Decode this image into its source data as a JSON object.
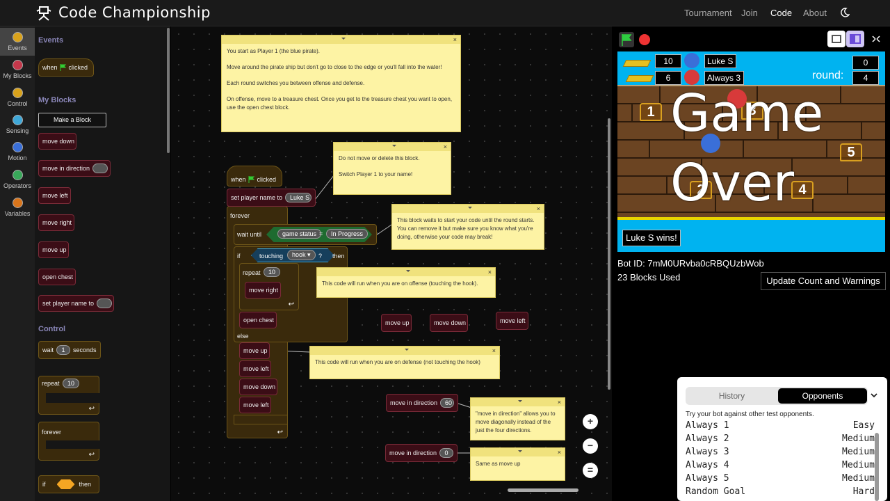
{
  "nav": {
    "brand": "Code Championship",
    "items": [
      "Tournament",
      "Join",
      "Code",
      "About"
    ],
    "active": "Code",
    "theme_icon": "moon-icon"
  },
  "categories": [
    {
      "label": "Events",
      "color": "#d9a21b"
    },
    {
      "label": "My Blocks",
      "color": "#c4384b"
    },
    {
      "label": "Control",
      "color": "#d9a21b"
    },
    {
      "label": "Sensing",
      "color": "#3fa8d8"
    },
    {
      "label": "Motion",
      "color": "#3a6fd8"
    },
    {
      "label": "Operators",
      "color": "#39a85a"
    },
    {
      "label": "Variables",
      "color": "#d9751b"
    }
  ],
  "flyout": {
    "events_title": "Events",
    "when_clicked": [
      "when",
      "clicked"
    ],
    "myblocks_title": "My Blocks",
    "make_block": "Make a Block",
    "my_blocks": [
      "move down",
      "move in direction",
      "move left",
      "move right",
      "move up",
      "open chest",
      "set player name to"
    ],
    "control_title": "Control",
    "wait": [
      "wait",
      "1",
      "seconds"
    ],
    "repeat": [
      "repeat",
      "10"
    ],
    "forever": "forever",
    "if": [
      "if",
      "then"
    ]
  },
  "notes": {
    "n1": [
      "You start as Player 1 (the blue pirate).",
      "Move around the pirate ship but don't go to close to the edge or you'll fall into the water!",
      "Each round switches you between offense and defense.",
      "On offense, move to a treasure chest. Once you get to the treasure chest you want to open, use the open chest block."
    ],
    "n2": [
      "Do not move or delete this block.",
      "Switch Player 1 to your name!"
    ],
    "n3": [
      "This block waits to start your code until the round starts. You can remove it but make sure you know what you're doing, otherwise your code may break!"
    ],
    "n4": [
      "This code will run when you are on offense (touching the hook)."
    ],
    "n5": [
      "This code will run when you are on defense (not touching the hook)"
    ],
    "n6": [
      "\"move in direction\" allows you to move diagonally instead of the just the four directions."
    ],
    "n7": [
      "Same as move up"
    ]
  },
  "script": {
    "when": [
      "when",
      "clicked"
    ],
    "set_name": [
      "set player name to",
      "Luke S"
    ],
    "forever": "forever",
    "wait_until": [
      "wait until",
      "game status",
      "=",
      "In Progress"
    ],
    "if": [
      "if",
      "touching",
      "hook",
      "?",
      "then"
    ],
    "repeat": [
      "repeat",
      "10"
    ],
    "move_right": "move right",
    "open_chest": "open chest",
    "else": "else",
    "defense": [
      "move up",
      "move left",
      "move down",
      "move left"
    ],
    "loose": [
      "move up",
      "move down",
      "move left"
    ],
    "mid1": [
      "move in direction",
      "60"
    ],
    "mid2": [
      "move in direction",
      "0"
    ]
  },
  "zoom": [
    "+",
    "−",
    "="
  ],
  "game": {
    "p1_score": "10",
    "p1_name": "Luke S",
    "p2_score": "6",
    "p2_name": "Always 3",
    "round_label": "round:",
    "right_top": "0",
    "round": "4",
    "chests": [
      "1",
      "3",
      "5",
      "2",
      "4"
    ],
    "game_over": [
      "Game",
      "Over"
    ],
    "winner": "Luke S wins!"
  },
  "bot": {
    "id": "Bot ID: 7mM0URvba0cRBQUzbWob",
    "blocks": "23 Blocks Used",
    "update": "Update Count and Warnings"
  },
  "history": {
    "tabs": [
      "History",
      "Opponents"
    ],
    "active_tab": "Opponents",
    "hint": "Try your bot against other test opponents.",
    "opponents": [
      {
        "name": "Always 1",
        "difficulty": "Easy"
      },
      {
        "name": "Always 2",
        "difficulty": "Medium"
      },
      {
        "name": "Always 3",
        "difficulty": "Medium"
      },
      {
        "name": "Always 4",
        "difficulty": "Medium"
      },
      {
        "name": "Always 5",
        "difficulty": "Medium"
      },
      {
        "name": "Random Goal",
        "difficulty": "Hard"
      }
    ]
  }
}
